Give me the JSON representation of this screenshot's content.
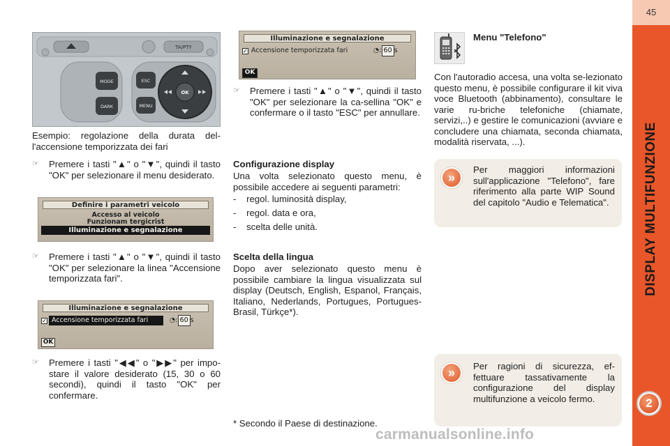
{
  "page": {
    "number": "45",
    "side_title": "DISPLAY MULTIFUNZIONE",
    "chapter_badge": "2",
    "watermark": "carmanualsonline.info",
    "accent_color": "#e8562a"
  },
  "panel_photo": {
    "buttons": [
      "TA/PTY",
      "MODE",
      "ESC",
      "OK",
      "DARK",
      "MENU"
    ]
  },
  "col1": {
    "caption": "Esempio: regolazione della durata del-l'accensione temporizzata dei fari",
    "step1": "Premere i tasti \"▲\" o \"▼\", quindi il tasto \"OK\" per selezionare il menu desiderato.",
    "screen1": {
      "title": "Definire i parametri veicolo",
      "items": [
        "Accesso al veicolo",
        "Funzionam tergicrist",
        "Illuminazione e segnalazione"
      ]
    },
    "step2": "Premere i tasti \"▲\" o \"▼\", quindi il tasto \"OK\" per selezionare la linea \"Accensione temporizzata fari\".",
    "screen2": {
      "title": "Illuminazione e segnalazione",
      "line": "Accensione temporizzata fari",
      "value": "60",
      "unit": "s",
      "ok": "OK"
    },
    "step3": "Premere i tasti \"◀◀\" o \"▶▶\" per impo-stare il valore desiderato (15, 30 o 60 secondi), quindi il tasto \"OK\" per confermare."
  },
  "col2": {
    "screen3": {
      "title": "Illuminazione e segnalazione",
      "line": "Accensione temporizzata fari",
      "value": "60",
      "unit": "s",
      "ok": "OK"
    },
    "step4": "Premere i tasti \"▲\" o \"▼\", quindi il tasto \"OK\" per selezionare la ca-sellina \"OK\" e confermare o il tasto \"ESC\" per annullare.",
    "config_heading": "Configurazione display",
    "config_intro": "Una volta selezionato questo menu, è possibile accedere ai seguenti parametri:",
    "config_items": [
      "regol. luminosità display,",
      "regol. data e ora,",
      "scelta delle unità."
    ],
    "lang_heading": "Scelta della lingua",
    "lang_text": "Dopo aver selezionato questo menu è possibile cambiare la lingua visualizzata sul display (Deutsch, English, Espanol, Français, Italiano, Nederlands, Portugues, Portugues-Brasil, Türkçe*).",
    "footnote": "* Secondo il Paese di destinazione."
  },
  "col3": {
    "heading": "Menu \"Telefono\"",
    "intro": "Con l'autoradio accesa, una volta se-lezionato questo menu, è possibile configurare il kit viva voce Bluetooth (abbinamento), consultare le varie ru-briche telefoniche (chiamate, servizi,..) e gestire le comunicazioni (avviare e concludere una chiamata, seconda chiamata, modalità riservata, ...).",
    "info1": "Per maggiori informazioni sull'applicazione \"Telefono\", fare riferimento alla parte WIP Sound del capitolo \"Audio e Telematica\".",
    "info2": "Per ragioni di sicurezza, ef-fettuare tassativamente la configurazione del display multifunzione a veicolo fermo."
  }
}
